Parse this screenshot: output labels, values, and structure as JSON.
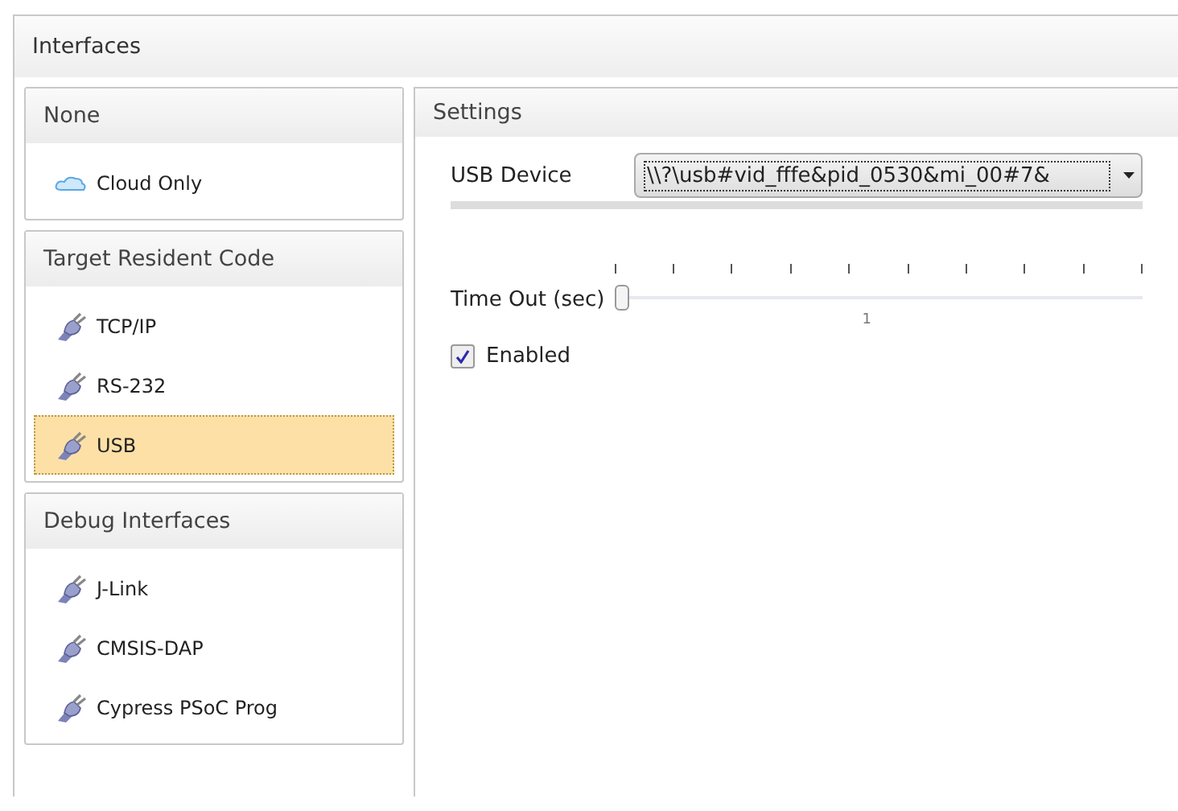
{
  "window": {
    "title": "Interfaces"
  },
  "groups": [
    {
      "title": "None",
      "items": [
        {
          "label": "Cloud Only",
          "kind": "cloud",
          "selected": false
        }
      ]
    },
    {
      "title": "Target Resident Code",
      "items": [
        {
          "label": "TCP/IP",
          "kind": "plug",
          "selected": false
        },
        {
          "label": "RS-232",
          "kind": "plug",
          "selected": false
        },
        {
          "label": "USB",
          "kind": "plug",
          "selected": true
        }
      ]
    },
    {
      "title": "Debug Interfaces",
      "items": [
        {
          "label": "J-Link",
          "kind": "plug",
          "selected": false
        },
        {
          "label": "CMSIS-DAP",
          "kind": "plug",
          "selected": false
        },
        {
          "label": "Cypress PSoC Prog",
          "kind": "plug",
          "selected": false
        }
      ]
    }
  ],
  "settings": {
    "title": "Settings",
    "usb_device": {
      "label": "USB Device",
      "value": "\\\\?\\usb#vid_fffe&pid_0530&mi_00#7&"
    },
    "timeout": {
      "label": "Time Out (sec)",
      "level": 0,
      "tick_label": "1"
    },
    "enabled": {
      "label": "Enabled",
      "checked": true
    }
  }
}
